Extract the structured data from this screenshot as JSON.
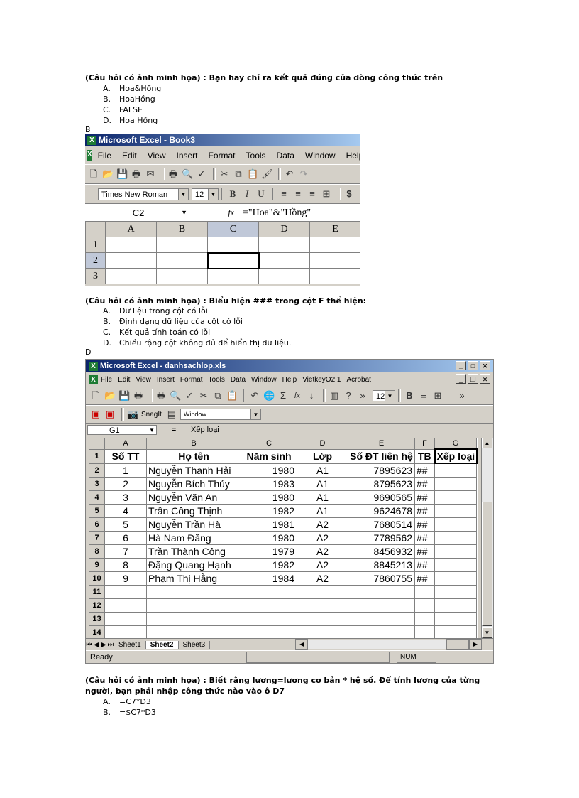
{
  "q1": {
    "question": "(Câu hỏi có ảnh minh họa) : Bạn hãy chỉ ra kết quả đúng của dòng công thức trên",
    "options": [
      {
        "letter": "A.",
        "text": "Hoa&Hồng"
      },
      {
        "letter": "B.",
        "text": "HoaHồng"
      },
      {
        "letter": "C.",
        "text": "FALSE"
      },
      {
        "letter": "D.",
        "text": "Hoa Hồng"
      }
    ],
    "answer": "B"
  },
  "excel1": {
    "title": "Microsoft Excel - Book3",
    "menu": [
      "File",
      "Edit",
      "View",
      "Insert",
      "Format",
      "Tools",
      "Data",
      "Window",
      "Help"
    ],
    "font": "Times New Roman",
    "size": "12",
    "cell_ref": "C2",
    "fx": "fx",
    "formula": "=\"Hoa\"&\"Hồng\"",
    "columns": [
      "A",
      "B",
      "C",
      "D",
      "E"
    ],
    "rows": [
      "1",
      "2",
      "3"
    ]
  },
  "q2": {
    "question": "(Câu hỏi có ảnh minh họa) : Biểu hiện ### trong cột F thể hiện:",
    "options": [
      {
        "letter": "A.",
        "text": "Dữ liệu trong cột có lỗi"
      },
      {
        "letter": "B.",
        "text": "Định dạng dữ liệu của cột có lỗi"
      },
      {
        "letter": "C.",
        "text": "Kết quả tính toán có lỗi"
      },
      {
        "letter": "D.",
        "text": "Chiều rộng cột không đủ để hiển thị dữ liệu."
      }
    ],
    "answer": "D"
  },
  "excel2": {
    "title": "Microsoft Excel - danhsachlop.xls",
    "menu": [
      "File",
      "Edit",
      "View",
      "Insert",
      "Format",
      "Tools",
      "Data",
      "Window",
      "Help",
      "VietkeyO2.1",
      "Acrobat"
    ],
    "size": "12",
    "snagit": "SnagIt",
    "window_combo": "Window",
    "cell_ref": "G1",
    "eq": "=",
    "formula": "Xếp loại",
    "columns": [
      "A",
      "B",
      "C",
      "D",
      "E",
      "F",
      "G"
    ],
    "headers": [
      "Số TT",
      "Họ tên",
      "Năm sinh",
      "Lớp",
      "Số ĐT liên hệ",
      "TB",
      "Xếp loại"
    ],
    "rows": [
      {
        "n": "2",
        "stt": "1",
        "name": "Nguyễn Thanh Hải",
        "year": "1980",
        "cls": "A1",
        "phone": "7895623",
        "tb": "##"
      },
      {
        "n": "3",
        "stt": "2",
        "name": "Nguyễn Bích Thủy",
        "year": "1983",
        "cls": "A1",
        "phone": "8795623",
        "tb": "##"
      },
      {
        "n": "4",
        "stt": "3",
        "name": "Nguyễn Văn An",
        "year": "1980",
        "cls": "A1",
        "phone": "9690565",
        "tb": "##"
      },
      {
        "n": "5",
        "stt": "4",
        "name": "Trần Công Thịnh",
        "year": "1982",
        "cls": "A1",
        "phone": "9624678",
        "tb": "##"
      },
      {
        "n": "6",
        "stt": "5",
        "name": "Nguyễn Trần Hà",
        "year": "1981",
        "cls": "A2",
        "phone": "7680514",
        "tb": "##"
      },
      {
        "n": "7",
        "stt": "6",
        "name": "Hà Nam Đăng",
        "year": "1980",
        "cls": "A2",
        "phone": "7789562",
        "tb": "##"
      },
      {
        "n": "8",
        "stt": "7",
        "name": "Trần Thành Công",
        "year": "1979",
        "cls": "A2",
        "phone": "8456932",
        "tb": "##"
      },
      {
        "n": "9",
        "stt": "8",
        "name": "Đặng Quang Hạnh",
        "year": "1982",
        "cls": "A2",
        "phone": "8845213",
        "tb": "##"
      },
      {
        "n": "10",
        "stt": "9",
        "name": "Phạm Thị Hằng",
        "year": "1984",
        "cls": "A2",
        "phone": "7860755",
        "tb": "##"
      }
    ],
    "empty_rows": [
      "11",
      "12",
      "13",
      "14"
    ],
    "sheet_tabs": [
      "Sheet1",
      "Sheet2",
      "Sheet3"
    ],
    "status": "Ready",
    "num": "NUM"
  },
  "q3": {
    "question_line1": "(Câu hỏi có ảnh minh họa) : Biết rằng lương=lương cơ bản * hệ số. Để tính lương của từng",
    "question_line2": "người, bạn phải nhập công thức nào vào ô D7",
    "options": [
      {
        "letter": "A.",
        "text": "=C7*D3"
      },
      {
        "letter": "B.",
        "text": "=$C7*D3"
      }
    ]
  }
}
